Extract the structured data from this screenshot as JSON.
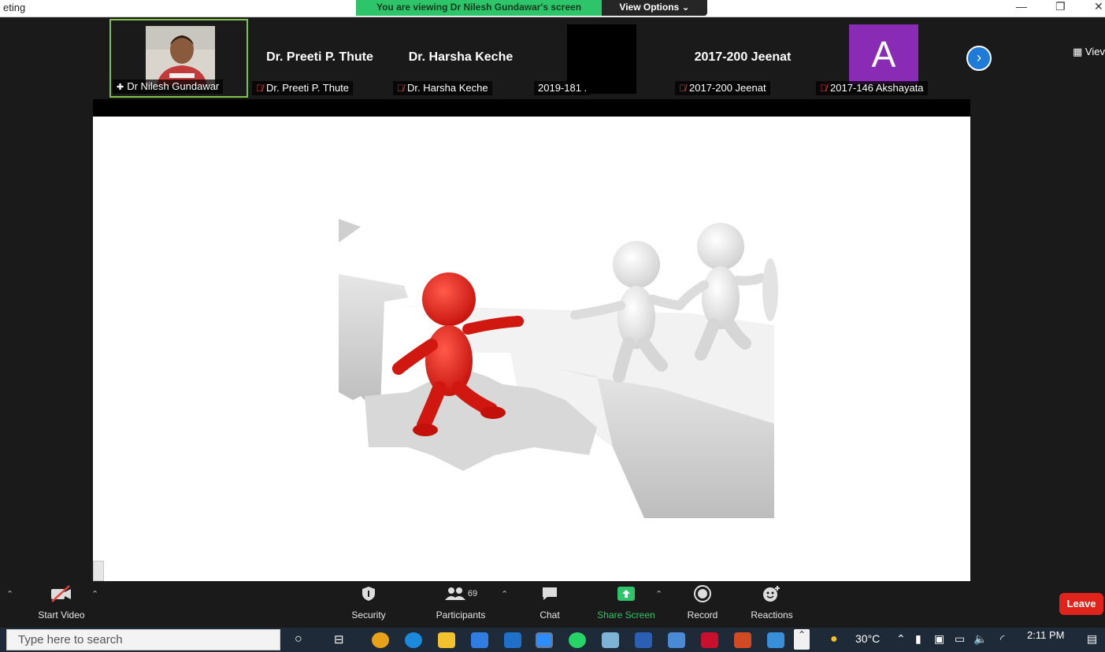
{
  "window": {
    "title": "eting",
    "viewing_banner": "You are viewing Dr Nilesh Gundawar's screen",
    "view_options_label": "View Options ⌄",
    "minimize": "—",
    "maximize": "❐",
    "close": "✕"
  },
  "gallery": {
    "tiles": [
      {
        "label": "Dr Nilesh Gundawar",
        "big_name": "",
        "type": "photo",
        "muted": false,
        "pinned": true
      },
      {
        "label": "Dr. Preeti P. Thute",
        "big_name": "Dr. Preeti P. Thute",
        "type": "name",
        "muted": true
      },
      {
        "label": "Dr. Harsha Keche",
        "big_name": "Dr. Harsha Keche",
        "type": "name",
        "muted": true
      },
      {
        "label": "2019-181 .",
        "big_name": "",
        "type": "video-black",
        "muted": false
      },
      {
        "label": "2017-200 Jeenat",
        "big_name": "2017-200 Jeenat",
        "type": "name",
        "muted": true
      },
      {
        "label": "2017-146 Akshayata",
        "big_name": "",
        "type": "avatar",
        "avatar_letter": "A",
        "avatar_color": "#8a2bb5",
        "muted": true
      }
    ],
    "view_label": "Viev"
  },
  "toolbar": {
    "start_video": "Start Video",
    "security": "Security",
    "participants": "Participants",
    "participants_count": "69",
    "chat": "Chat",
    "share_screen": "Share Screen",
    "record": "Record",
    "reactions": "Reactions",
    "leave": "Leave",
    "colors": {
      "share_green": "#2ec56a",
      "leave_red": "#e0241b"
    }
  },
  "taskbar": {
    "search_placeholder": "Type here to search",
    "weather": "30°C",
    "time": "2:11 PM"
  }
}
